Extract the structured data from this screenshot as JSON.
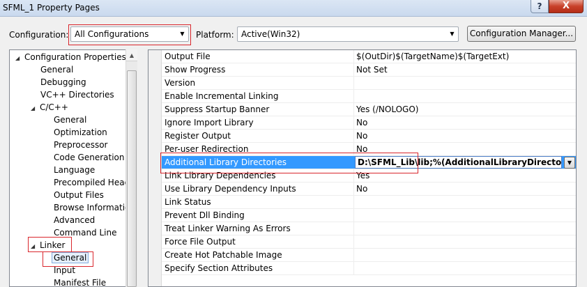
{
  "window": {
    "title": "SFML_1 Property Pages",
    "help": "?",
    "close": "X"
  },
  "toolbar": {
    "configuration_label": "Configuration:",
    "configuration_value": "All Configurations",
    "platform_label": "Platform:",
    "platform_value": "Active(Win32)",
    "config_manager_label": "Configuration Manager..."
  },
  "tree": {
    "items": [
      {
        "label": "Configuration Properties",
        "toggle": "◢"
      },
      {
        "label": "General"
      },
      {
        "label": "Debugging"
      },
      {
        "label": "VC++ Directories"
      },
      {
        "label": "C/C++",
        "toggle": "◢"
      },
      {
        "label": "General"
      },
      {
        "label": "Optimization"
      },
      {
        "label": "Preprocessor"
      },
      {
        "label": "Code Generation"
      },
      {
        "label": "Language"
      },
      {
        "label": "Precompiled Heade"
      },
      {
        "label": "Output Files"
      },
      {
        "label": "Browse Information"
      },
      {
        "label": "Advanced"
      },
      {
        "label": "Command Line"
      },
      {
        "label": "Linker",
        "toggle": "◢"
      },
      {
        "label": "General",
        "selected": true
      },
      {
        "label": "Input"
      },
      {
        "label": "Manifest File"
      }
    ]
  },
  "properties": [
    {
      "name": "Output File",
      "value": "$(OutDir)$(TargetName)$(TargetExt)"
    },
    {
      "name": "Show Progress",
      "value": "Not Set"
    },
    {
      "name": "Version",
      "value": ""
    },
    {
      "name": "Enable Incremental Linking",
      "value": ""
    },
    {
      "name": "Suppress Startup Banner",
      "value": "Yes (/NOLOGO)"
    },
    {
      "name": "Ignore Import Library",
      "value": "No"
    },
    {
      "name": "Register Output",
      "value": "No"
    },
    {
      "name": "Per-user Redirection",
      "value": "No"
    },
    {
      "name": "Additional Library Directories",
      "value": "D:\\SFML_Lib\\lib;%(AdditionalLibraryDirectories)",
      "selected": true
    },
    {
      "name": "Link Library Dependencies",
      "value": "Yes"
    },
    {
      "name": "Use Library Dependency Inputs",
      "value": "No"
    },
    {
      "name": "Link Status",
      "value": ""
    },
    {
      "name": "Prevent Dll Binding",
      "value": ""
    },
    {
      "name": "Treat Linker Warning As Errors",
      "value": ""
    },
    {
      "name": "Force File Output",
      "value": ""
    },
    {
      "name": "Create Hot Patchable Image",
      "value": ""
    },
    {
      "name": "Specify Section Attributes",
      "value": ""
    }
  ],
  "colors": {
    "highlight": "#3399ff",
    "annotation_red": "#d9262c"
  }
}
